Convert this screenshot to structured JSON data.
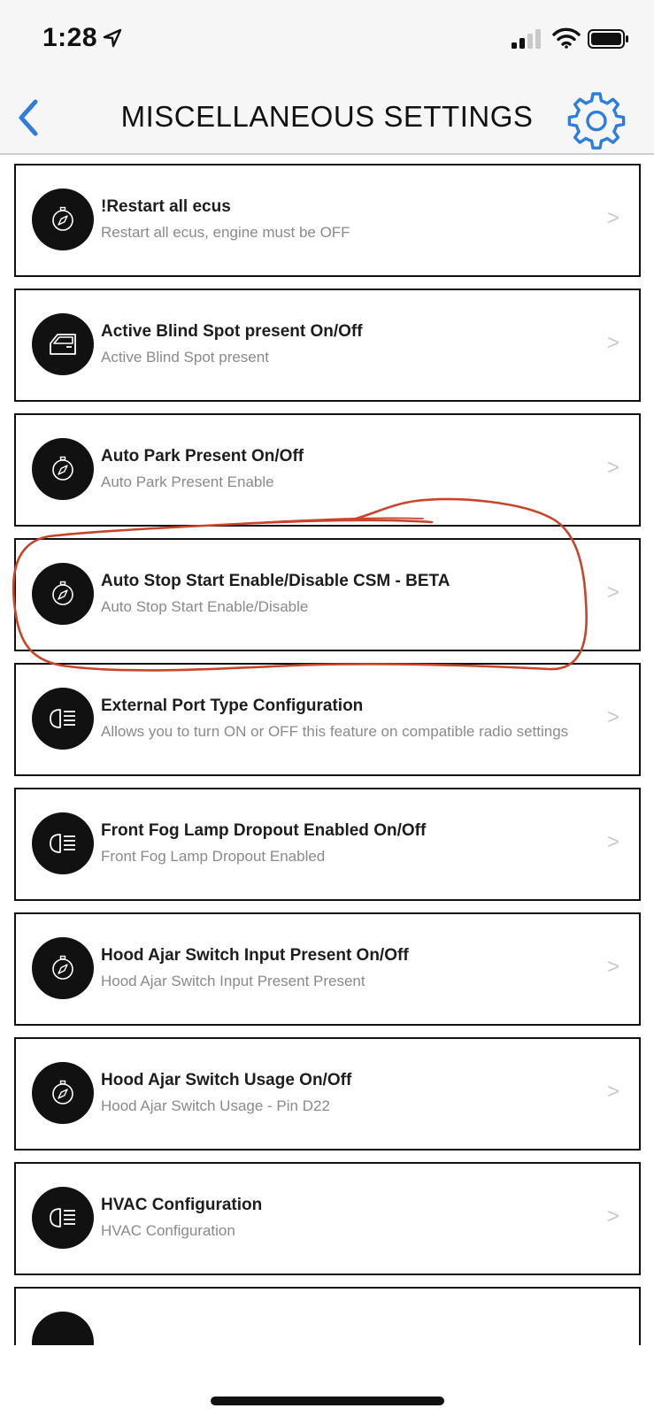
{
  "status_bar": {
    "time": "1:28",
    "icons": [
      "location-arrow-icon",
      "cellular-signal-icon",
      "wifi-icon",
      "battery-icon"
    ]
  },
  "nav": {
    "title": "MISCELLANEOUS SETTINGS",
    "back_icon": "chevron-left-icon",
    "settings_icon": "gear-icon"
  },
  "colors": {
    "accent": "#2f7ddb",
    "annotation": "#c8452b",
    "subtitle": "#8a8a8a",
    "chevron": "#c8c8c8"
  },
  "items": [
    {
      "title": "!Restart all ecus",
      "subtitle": "Restart all ecus, engine must be OFF",
      "icon": "compass-icon",
      "chevron": ">"
    },
    {
      "title": "Active Blind Spot present On/Off",
      "subtitle": "Active Blind Spot present",
      "icon": "car-door-icon",
      "chevron": ">"
    },
    {
      "title": "Auto Park Present On/Off",
      "subtitle": "Auto Park Present Enable",
      "icon": "compass-icon",
      "chevron": ">"
    },
    {
      "title": "Auto Stop Start Enable/Disable CSM - BETA",
      "subtitle": "Auto Stop Start Enable/Disable",
      "icon": "compass-icon",
      "chevron": ">"
    },
    {
      "title": "External Port Type Configuration",
      "subtitle": "Allows you to turn ON or OFF this feature on compatible radio settings",
      "icon": "headlight-icon",
      "chevron": ">"
    },
    {
      "title": "Front Fog Lamp Dropout Enabled On/Off",
      "subtitle": "Front Fog Lamp Dropout Enabled",
      "icon": "headlight-icon",
      "chevron": ">"
    },
    {
      "title": "Hood Ajar Switch Input Present On/Off",
      "subtitle": "Hood Ajar Switch Input Present Present",
      "icon": "compass-icon",
      "chevron": ">"
    },
    {
      "title": "Hood Ajar Switch Usage On/Off",
      "subtitle": "Hood Ajar Switch Usage - Pin D22",
      "icon": "compass-icon",
      "chevron": ">"
    },
    {
      "title": "HVAC Configuration",
      "subtitle": "HVAC Configuration",
      "icon": "headlight-icon",
      "chevron": ">"
    },
    {
      "title": "",
      "subtitle": "",
      "icon": "",
      "chevron": ""
    }
  ]
}
